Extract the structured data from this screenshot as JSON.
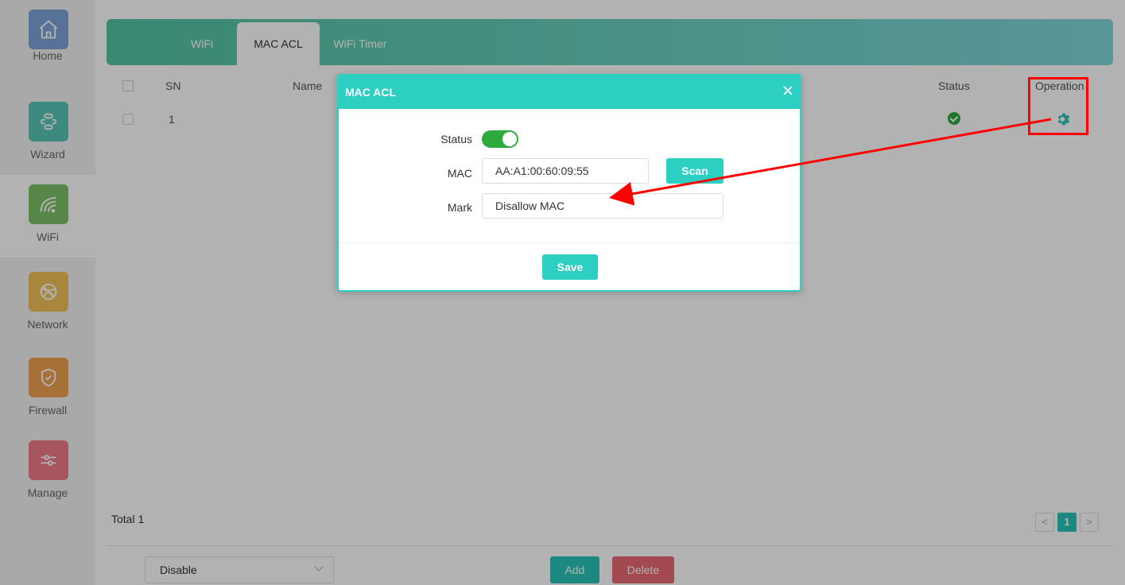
{
  "sidebar": {
    "items": [
      {
        "label": "Home",
        "icon": "home-icon",
        "color": "#7da3d9"
      },
      {
        "label": "Wizard",
        "icon": "link-icon",
        "color": "#56c6b8"
      },
      {
        "label": "WiFi",
        "icon": "wifi-icon",
        "color": "#7bc067"
      },
      {
        "label": "Network",
        "icon": "globe-icon",
        "color": "#f3c15a"
      },
      {
        "label": "Firewall",
        "icon": "shield-icon",
        "color": "#f0a14e"
      },
      {
        "label": "Manage",
        "icon": "sliders-icon",
        "color": "#f07c8a"
      }
    ]
  },
  "tabs": [
    {
      "label": "WiFi"
    },
    {
      "label": "MAC ACL"
    },
    {
      "label": "WiFi Timer"
    }
  ],
  "table": {
    "columns": {
      "sn": "SN",
      "name": "Name",
      "status": "Status",
      "operation": "Operation"
    },
    "rows": [
      {
        "sn": "1",
        "status": "enabled"
      }
    ]
  },
  "footer": {
    "total": "Total 1",
    "prev": "<",
    "page": "1",
    "next": ">",
    "select_value": "Disable",
    "add_label": "Add",
    "delete_label": "Delete"
  },
  "modal": {
    "title": "MAC ACL",
    "status_label": "Status",
    "status_on": true,
    "mac_label": "MAC",
    "mac_value": "AA:A1:00:60:09:55",
    "scan_label": "Scan",
    "mark_label": "Mark",
    "mark_value": "Disallow MAC",
    "save_label": "Save"
  },
  "colors": {
    "accent": "#2ecfc3",
    "success": "#2eaa3c",
    "danger": "#e86a73",
    "annotation": "#ff0000"
  }
}
